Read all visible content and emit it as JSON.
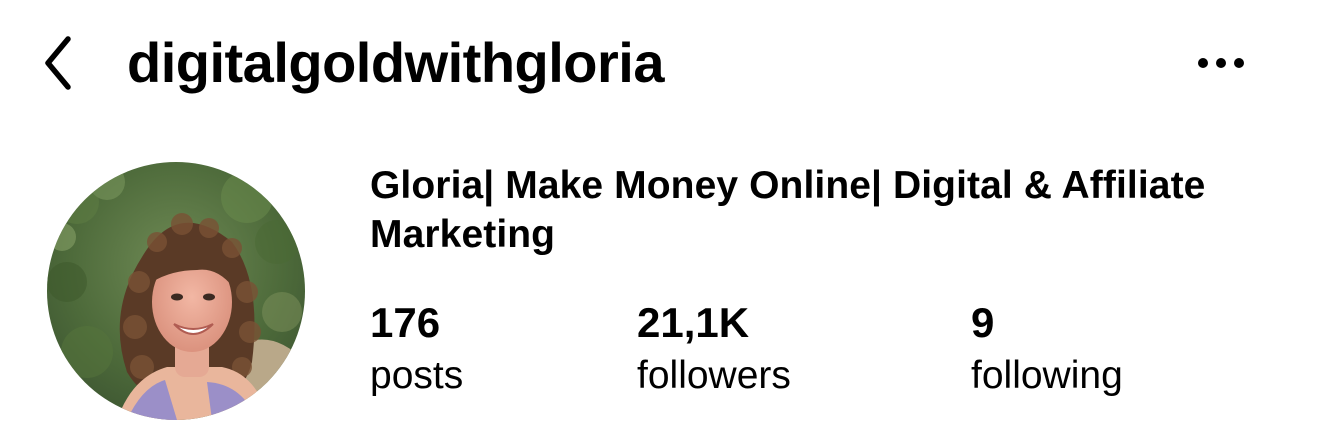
{
  "header": {
    "username": "digitalgoldwithgloria",
    "back_icon": "chevron-left-icon",
    "more_icon": "more-horizontal-icon"
  },
  "profile": {
    "display_name": "Gloria| Make Money Online| Digital & Affiliate Marketing",
    "avatar": "profile-photo"
  },
  "stats": {
    "posts": {
      "value": "176",
      "label": "posts"
    },
    "followers": {
      "value": "21,1K",
      "label": "followers"
    },
    "following": {
      "value": "9",
      "label": "following"
    }
  },
  "colors": {
    "text": "#000000",
    "background": "#ffffff"
  }
}
